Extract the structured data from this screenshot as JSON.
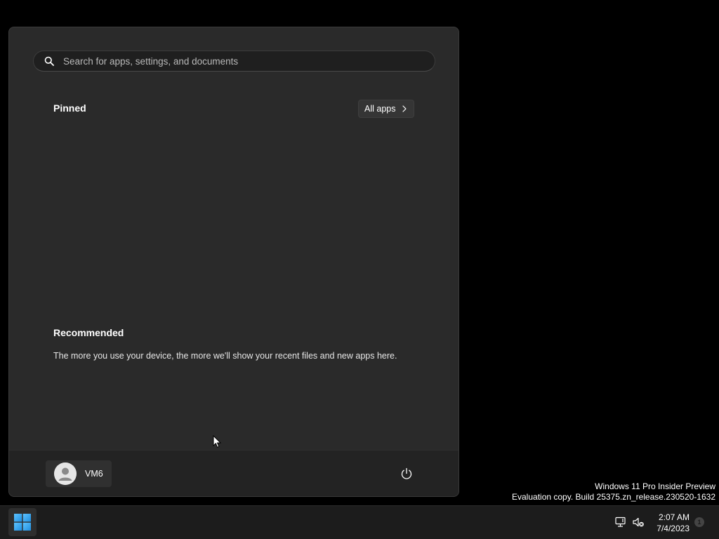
{
  "start_menu": {
    "search": {
      "placeholder": "Search for apps, settings, and documents",
      "icon": "search-icon"
    },
    "pinned": {
      "title": "Pinned",
      "all_apps_label": "All apps",
      "items": []
    },
    "recommended": {
      "title": "Recommended",
      "empty_message": "The more you use your device, the more we'll show your recent files and new apps here."
    },
    "footer": {
      "user_name": "VM6",
      "power_icon": "power-icon"
    }
  },
  "watermark": {
    "line1": "Windows 11 Pro Insider Preview",
    "line2": "Evaluation copy. Build 25375.zn_release.230520-1632"
  },
  "taskbar": {
    "start_icon": "windows-logo-icon",
    "tray": {
      "network_icon": "network-disconnected-icon",
      "volume_icon": "volume-muted-icon",
      "time": "2:07 AM",
      "date": "7/4/2023",
      "notifications_count": "1"
    }
  },
  "colors": {
    "menu_bg": "#2a2a2a",
    "footer_bg": "#232323",
    "taskbar_bg": "#1c1c1c",
    "desktop_bg": "#000000",
    "windows_blue": "#3aa0e8"
  }
}
